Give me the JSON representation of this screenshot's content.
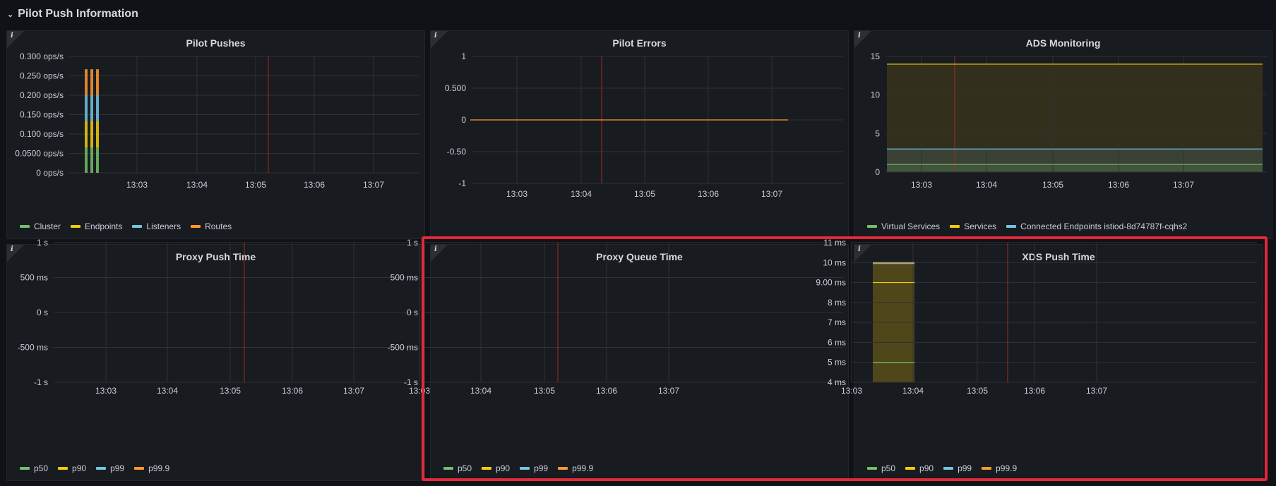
{
  "row": {
    "title": "Pilot Push Information",
    "chevron": "⌄"
  },
  "colors": {
    "green": "#73bf69",
    "yellow": "#f2cc0c",
    "blue": "#73c5e4",
    "orange": "#ff9830",
    "grid": "#2f3136",
    "axis_text": "#ccccdc",
    "now_line": "#a72a2a"
  },
  "panels": [
    {
      "id": "pilot-pushes",
      "title": "Pilot Pushes",
      "info": "i",
      "y_ticks": [
        "0.300 ops/s",
        "0.250 ops/s",
        "0.200 ops/s",
        "0.150 ops/s",
        "0.100 ops/s",
        "0.0500 ops/s",
        "0 ops/s"
      ],
      "x_ticks": [
        "13:03",
        "13:04",
        "13:05",
        "13:06",
        "13:07"
      ],
      "legend": [
        {
          "label": "Cluster",
          "color": "#73bf69"
        },
        {
          "label": "Endpoints",
          "color": "#f2cc0c"
        },
        {
          "label": "Listeners",
          "color": "#73c5e4"
        },
        {
          "label": "Routes",
          "color": "#ff9830"
        }
      ]
    },
    {
      "id": "pilot-errors",
      "title": "Pilot Errors",
      "info": "i",
      "y_ticks": [
        "1",
        "0.500",
        "0",
        "-0.50",
        "-1"
      ],
      "x_ticks": [
        "13:03",
        "13:04",
        "13:05",
        "13:06",
        "13:07"
      ],
      "legend": []
    },
    {
      "id": "ads-monitoring",
      "title": "ADS Monitoring",
      "info": "i",
      "y_ticks": [
        "15",
        "10",
        "5",
        "0"
      ],
      "x_ticks": [
        "13:03",
        "13:04",
        "13:05",
        "13:06",
        "13:07"
      ],
      "legend": [
        {
          "label": "Virtual Services",
          "color": "#73bf69"
        },
        {
          "label": "Services",
          "color": "#f2cc0c"
        },
        {
          "label": "Connected Endpoints istiod-8d74787f-cqhs2",
          "color": "#73c5e4"
        }
      ]
    },
    {
      "id": "proxy-push-time",
      "title": "Proxy Push Time",
      "info": "i",
      "y_ticks": [
        "1 s",
        "500 ms",
        "0 s",
        "-500 ms",
        "-1 s"
      ],
      "x_ticks": [
        "13:03",
        "13:04",
        "13:05",
        "13:06",
        "13:07"
      ],
      "legend": [
        {
          "label": "p50",
          "color": "#73bf69"
        },
        {
          "label": "p90",
          "color": "#f2cc0c"
        },
        {
          "label": "p99",
          "color": "#73c5e4"
        },
        {
          "label": "p99.9",
          "color": "#ff9830"
        }
      ]
    },
    {
      "id": "proxy-queue-time",
      "title": "Proxy Queue Time",
      "info": "i",
      "y_ticks": [
        "1 s",
        "500 ms",
        "0 s",
        "-500 ms",
        "-1 s"
      ],
      "x_ticks": [
        "13:03",
        "13:04",
        "13:05",
        "13:06",
        "13:07"
      ],
      "legend": [
        {
          "label": "p50",
          "color": "#73bf69"
        },
        {
          "label": "p90",
          "color": "#f2cc0c"
        },
        {
          "label": "p99",
          "color": "#73c5e4"
        },
        {
          "label": "p99.9",
          "color": "#ff9830"
        }
      ]
    },
    {
      "id": "xds-push-time",
      "title": "XDS Push Time",
      "info": "i",
      "y_ticks": [
        "11 ms",
        "10 ms",
        "9.00 ms",
        "8 ms",
        "7 ms",
        "6 ms",
        "5 ms",
        "4 ms"
      ],
      "x_ticks": [
        "13:03",
        "13:04",
        "13:05",
        "13:06",
        "13:07"
      ],
      "legend": [
        {
          "label": "p50",
          "color": "#73bf69"
        },
        {
          "label": "p90",
          "color": "#f2cc0c"
        },
        {
          "label": "p99",
          "color": "#73c5e4"
        },
        {
          "label": "p99.9",
          "color": "#ff9830"
        }
      ]
    }
  ],
  "series": {
    "pilot_pushes_bars": [
      {
        "stack": [
          0.065,
          0.068,
          0.067,
          0.067
        ]
      },
      {
        "stack": [
          0.065,
          0.068,
          0.067,
          0.067
        ]
      },
      {
        "stack": [
          0.065,
          0.068,
          0.067,
          0.067
        ]
      }
    ],
    "pilot_errors_value": 0,
    "ads_monitoring": {
      "virtual_services": 1,
      "services": 14,
      "connected_endpoints": 3
    },
    "xds_push_time": {
      "p50_ms": 5,
      "p90_ms": 9,
      "p99_ms": 9.95,
      "p99_9_ms": 10
    }
  }
}
